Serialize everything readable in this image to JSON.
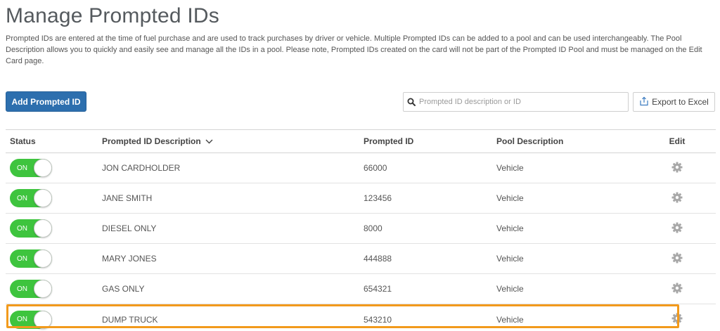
{
  "page": {
    "title": "Manage Prompted IDs",
    "intro": "Prompted IDs are entered at the time of fuel purchase and are used to track purchases by driver or vehicle. Multiple Prompted IDs can be added to a pool and can be used interchangeably. The Pool Description allows you to quickly and easily see and manage all the IDs in a pool. Please note, Prompted IDs created on the card will not be part of the Prompted ID Pool and must be managed on the Edit Card page."
  },
  "toolbar": {
    "add_label": "Add Prompted ID",
    "search_placeholder": "Prompted ID description or ID",
    "search_value": "",
    "export_label": "Export to Excel"
  },
  "table": {
    "headers": {
      "status": "Status",
      "description": "Prompted ID Description",
      "prompted_id": "Prompted ID",
      "pool": "Pool Description",
      "edit": "Edit"
    },
    "rows": [
      {
        "status": "ON",
        "description": "JON CARDHOLDER",
        "prompted_id": "66000",
        "pool": "Vehicle"
      },
      {
        "status": "ON",
        "description": "JANE SMITH",
        "prompted_id": "123456",
        "pool": "Vehicle"
      },
      {
        "status": "ON",
        "description": "DIESEL ONLY",
        "prompted_id": "8000",
        "pool": "Vehicle"
      },
      {
        "status": "ON",
        "description": "MARY JONES",
        "prompted_id": "444888",
        "pool": "Vehicle"
      },
      {
        "status": "ON",
        "description": "GAS ONLY",
        "prompted_id": "654321",
        "pool": "Vehicle"
      },
      {
        "status": "ON",
        "description": "DUMP TRUCK",
        "prompted_id": "543210",
        "pool": "Vehicle"
      }
    ]
  },
  "colors": {
    "primary_button": "#2d6fae",
    "toggle_on": "#3ec43e",
    "highlight": "#f29a1c",
    "gear": "#a8a8a8"
  },
  "icons": {
    "search": "search-icon",
    "export": "export-icon",
    "sort": "chevron-down-icon",
    "edit": "gear-icon"
  }
}
